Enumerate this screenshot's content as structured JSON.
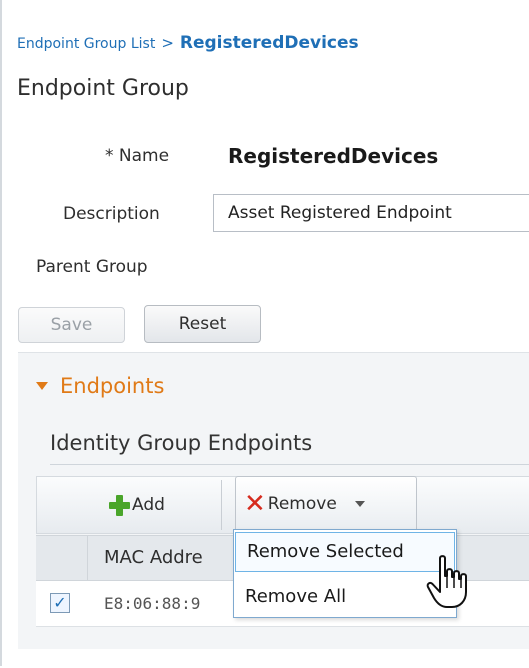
{
  "breadcrumb": {
    "parent": "Endpoint Group List",
    "separator": ">",
    "current": "RegisteredDevices"
  },
  "page_title": "Endpoint Group",
  "form": {
    "name_label": "* Name",
    "name_value": "RegisteredDevices",
    "description_label": "Description",
    "description_value": "Asset Registered Endpoint",
    "parent_group_label": "Parent Group",
    "save_label": "Save",
    "reset_label": "Reset"
  },
  "endpoints": {
    "section_label": "Endpoints",
    "subsection_title": "Identity Group Endpoints",
    "toolbar": {
      "add_label": "Add",
      "remove_label": "Remove"
    },
    "columns": {
      "mac": "MAC Addre"
    },
    "rows": [
      {
        "checked": true,
        "mac": "E8:06:88:9"
      }
    ],
    "remove_menu": {
      "items": [
        "Remove Selected",
        "Remove All"
      ],
      "highlighted": "Remove Selected"
    }
  },
  "colors": {
    "link": "#1f6fb6",
    "section_accent": "#e07a17",
    "add_icon": "#4aa52a",
    "remove_icon": "#d62b1e",
    "menu_highlight_border": "#6fb4e6"
  },
  "icons": [
    "plus-icon",
    "x-icon",
    "chevron-down-icon",
    "checkbox-checked-icon",
    "hand-pointer-icon",
    "triangle-down-icon"
  ]
}
